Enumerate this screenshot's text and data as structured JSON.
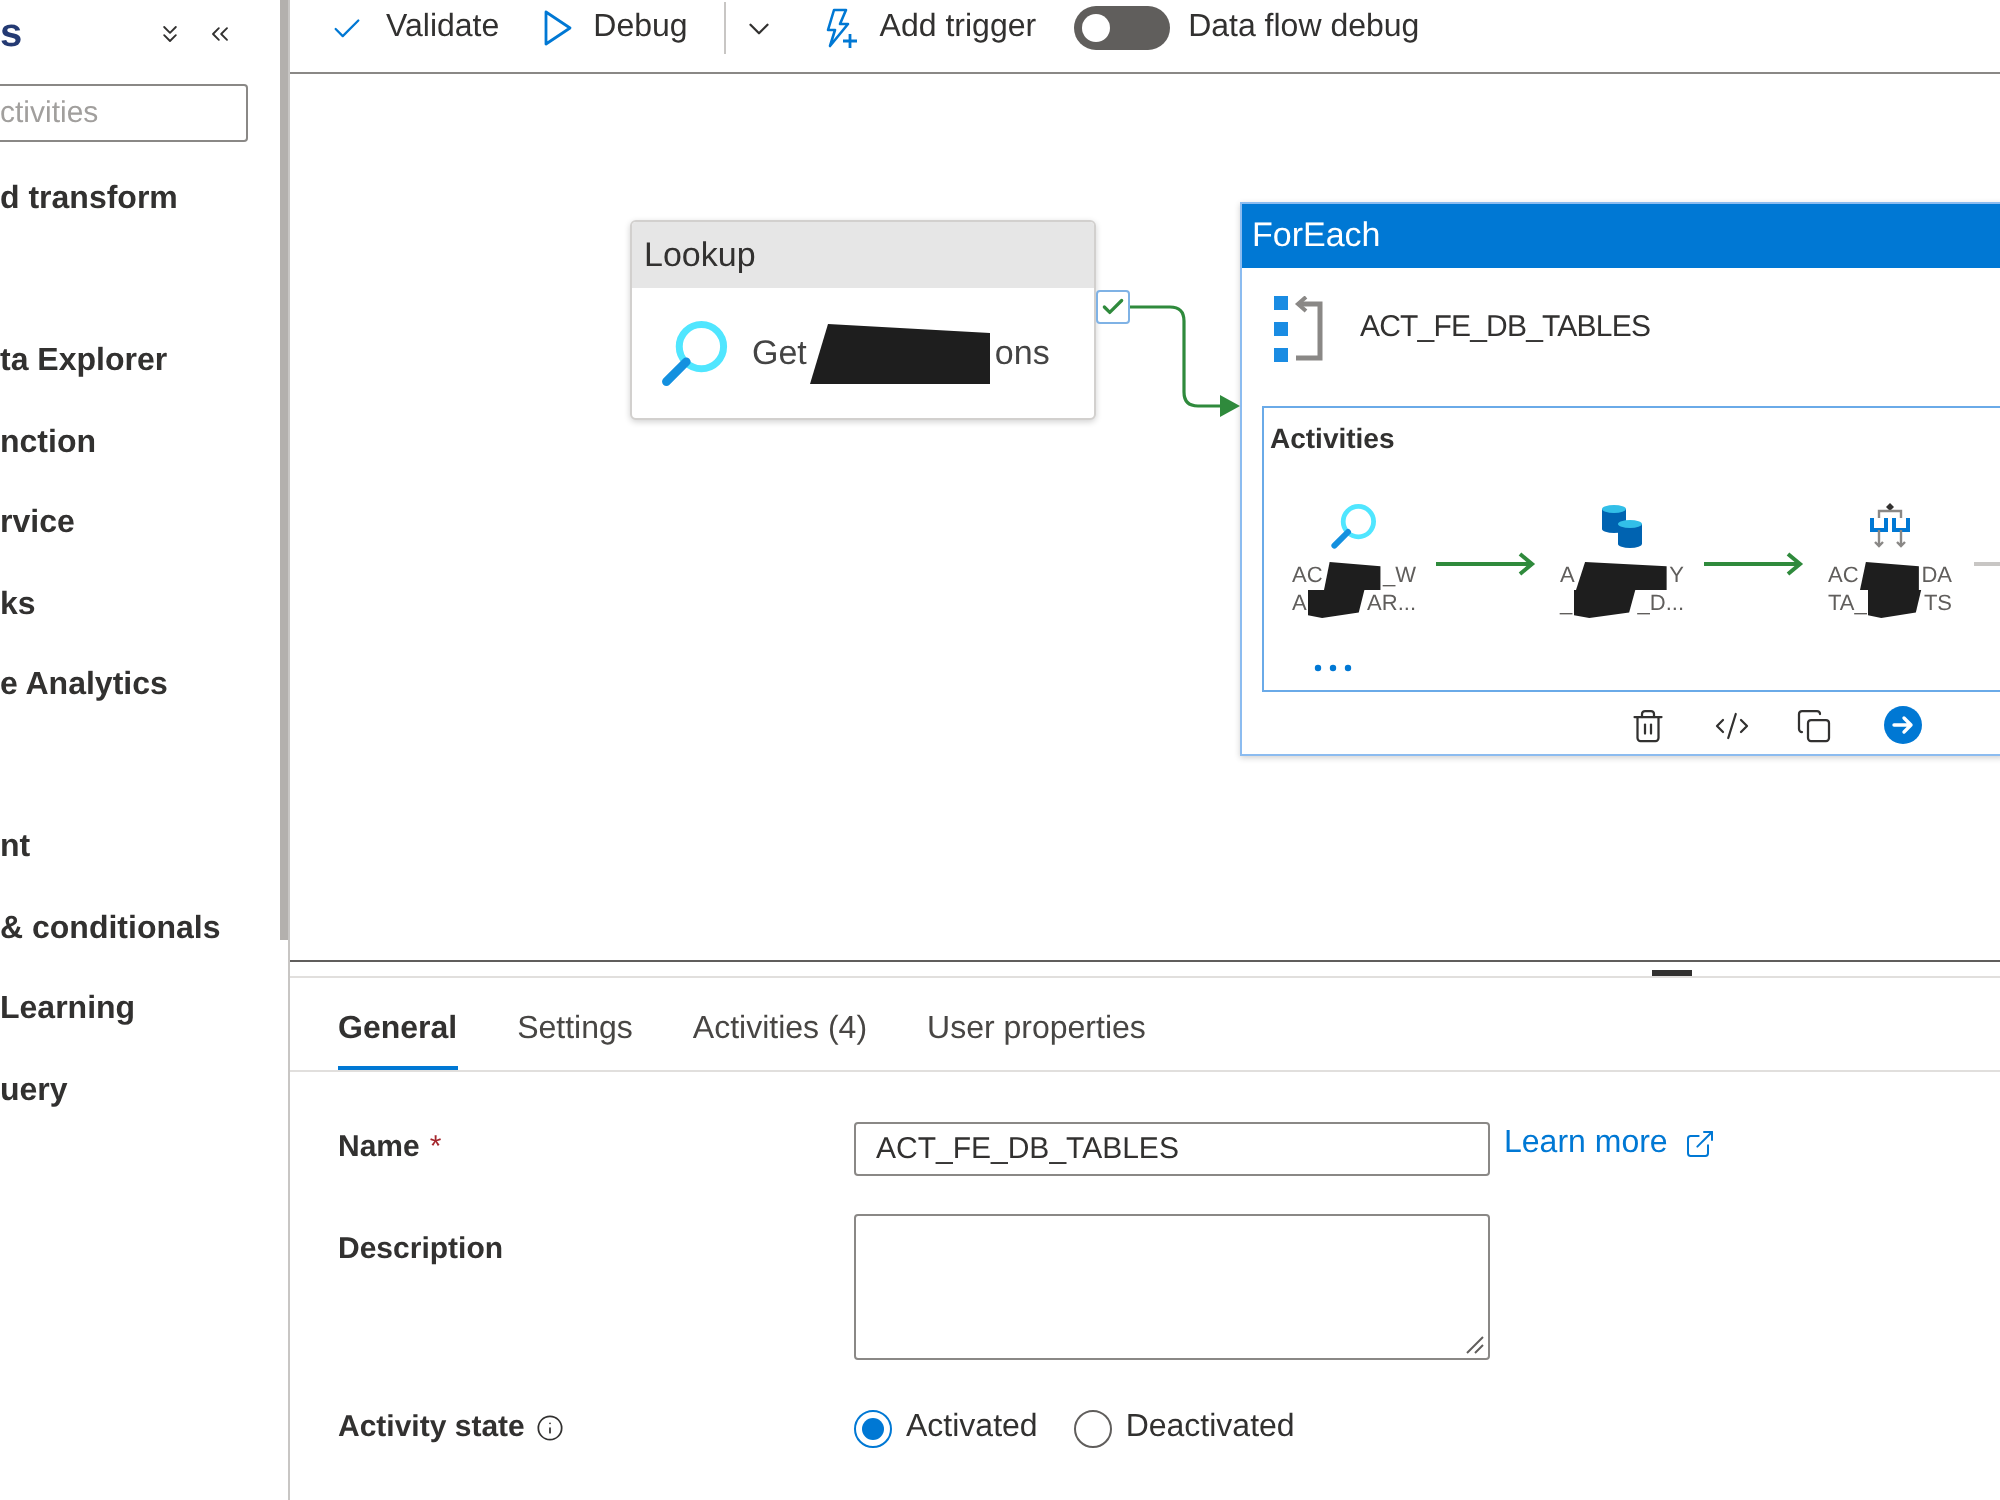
{
  "sidebar": {
    "heading": "s",
    "search": {
      "placeholder": "ctivities"
    },
    "groups": [
      {
        "items": [
          "d transform"
        ]
      },
      {
        "items": [
          "ta Explorer",
          "nction",
          "rvice",
          "ks",
          "e Analytics"
        ]
      },
      {
        "items": [
          "nt",
          "& conditionals",
          "Learning",
          "uery"
        ]
      }
    ]
  },
  "toolbar": {
    "buttons": [
      {
        "kind": "validate",
        "label": "Validate"
      },
      {
        "kind": "debug",
        "label": "Debug"
      },
      {
        "kind": "menu"
      },
      {
        "kind": "trigger",
        "label": "Add trigger"
      }
    ],
    "toggle": {
      "label": "Data flow debug",
      "on": false
    }
  },
  "canvas": {
    "lookup": {
      "type": "Lookup",
      "name_fragments": [
        "Get",
        "ons"
      ],
      "output_link": {
        "kind": "success"
      }
    },
    "foreach": {
      "type": "ForEach",
      "name": "ACT_FE_DB_TABLES",
      "activities_heading": "Activities",
      "activities": [
        {
          "kind": "lookup",
          "name_lines": [
            [
              "AC",
              "_W"
            ],
            [
              "A",
              "AR..."
            ]
          ],
          "link": {
            "kind": "success"
          }
        },
        {
          "kind": "copy",
          "name_lines": [
            [
              "A",
              "Y"
            ],
            [
              "_",
              "_D..."
            ]
          ],
          "link": {
            "kind": "success"
          }
        },
        {
          "kind": "if_condition",
          "name_lines": [
            [
              "AC",
              "DA"
            ],
            [
              "TA_",
              "TS"
            ]
          ],
          "link": {
            "kind": "skipped"
          }
        }
      ]
    }
  },
  "properties": {
    "tabs": [
      {
        "label": "General",
        "selected": true
      },
      {
        "label": "Settings",
        "selected": false
      },
      {
        "label": "Activities (4)",
        "selected": false
      },
      {
        "label": "User properties",
        "selected": false
      }
    ],
    "fields": [
      {
        "kind": "text",
        "label": "Name",
        "required_mark": "*",
        "value": "ACT_FE_DB_TABLES",
        "link": "Learn more",
        "info": false
      },
      {
        "kind": "textarea",
        "label": "Description",
        "info": false
      },
      {
        "kind": "radio",
        "label": "Activity state",
        "info": true,
        "options": [
          {
            "label": "Activated",
            "selected": true
          },
          {
            "label": "Deactivated",
            "selected": false
          }
        ]
      }
    ]
  }
}
